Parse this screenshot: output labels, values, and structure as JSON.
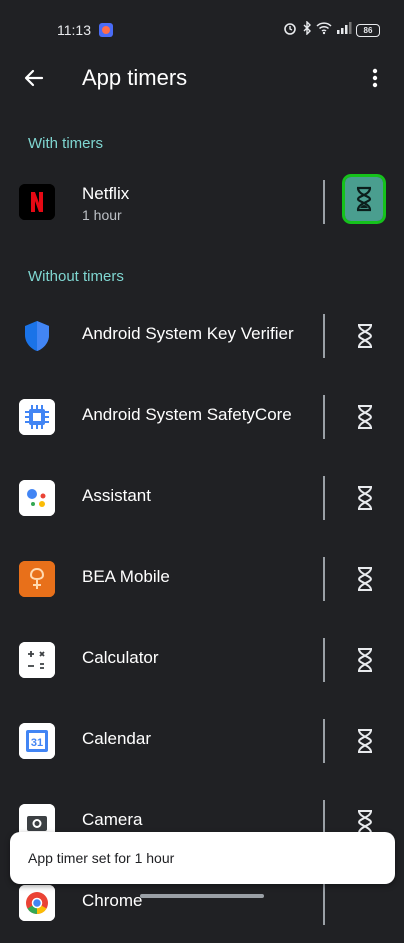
{
  "status_bar": {
    "time": "11:13",
    "battery": "86"
  },
  "app_bar": {
    "title": "App timers"
  },
  "sections": {
    "with_timers": "With timers",
    "without_timers": "Without timers"
  },
  "with_timers": [
    {
      "name": "Netflix",
      "sub": "1 hour",
      "icon": "netflix-icon",
      "timer_active": true
    }
  ],
  "without_timers": [
    {
      "name": "Android System Key Verifier",
      "icon": "shield-icon"
    },
    {
      "name": "Android System SafetyCore",
      "icon": "chip-icon"
    },
    {
      "name": "Assistant",
      "icon": "assistant-icon"
    },
    {
      "name": "BEA Mobile",
      "icon": "bea-mobile-icon"
    },
    {
      "name": "Calculator",
      "icon": "calculator-icon"
    },
    {
      "name": "Calendar",
      "icon": "calendar-icon",
      "icon_text": "31"
    },
    {
      "name": "Camera",
      "icon": "camera-icon"
    },
    {
      "name": "Chrome",
      "icon": "chrome-icon"
    }
  ],
  "toast": {
    "message": "App timer set for 1 hour"
  },
  "colors": {
    "background": "#202124",
    "section_label": "#7fd6d1",
    "timer_active_bg": "#4a9e8f",
    "highlight": "#15c21b"
  }
}
